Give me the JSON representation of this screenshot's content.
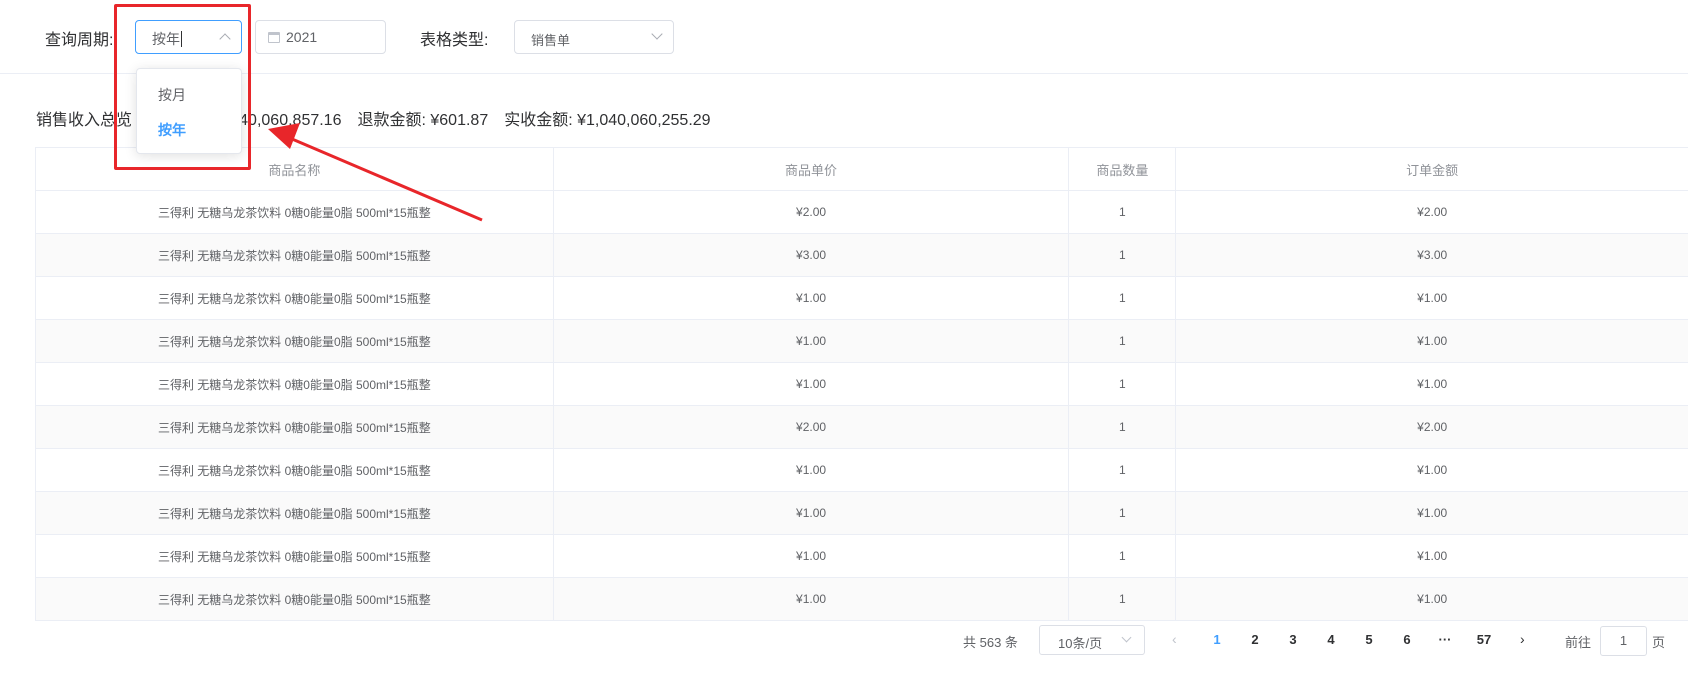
{
  "filters": {
    "period_label": "查询周期:",
    "period_value": "按年",
    "period_options": [
      "按月",
      "按年"
    ],
    "date_value": "2021",
    "type_label": "表格类型:",
    "type_value": "销售单"
  },
  "summary": {
    "label": "销售收入总览",
    "total_fragment": "：¥1,040,060,857.16",
    "refund": "退款金额: ¥601.87",
    "actual": "实收金额: ¥1,040,060,255.29"
  },
  "table": {
    "headers": [
      "商品名称",
      "商品单价",
      "商品数量",
      "订单金额"
    ],
    "rows": [
      [
        "三得利 无糖乌龙茶饮料 0糖0能量0脂 500ml*15瓶整",
        "¥2.00",
        "1",
        "¥2.00"
      ],
      [
        "三得利 无糖乌龙茶饮料 0糖0能量0脂 500ml*15瓶整",
        "¥3.00",
        "1",
        "¥3.00"
      ],
      [
        "三得利 无糖乌龙茶饮料 0糖0能量0脂 500ml*15瓶整",
        "¥1.00",
        "1",
        "¥1.00"
      ],
      [
        "三得利 无糖乌龙茶饮料 0糖0能量0脂 500ml*15瓶整",
        "¥1.00",
        "1",
        "¥1.00"
      ],
      [
        "三得利 无糖乌龙茶饮料 0糖0能量0脂 500ml*15瓶整",
        "¥1.00",
        "1",
        "¥1.00"
      ],
      [
        "三得利 无糖乌龙茶饮料 0糖0能量0脂 500ml*15瓶整",
        "¥2.00",
        "1",
        "¥2.00"
      ],
      [
        "三得利 无糖乌龙茶饮料 0糖0能量0脂 500ml*15瓶整",
        "¥1.00",
        "1",
        "¥1.00"
      ],
      [
        "三得利 无糖乌龙茶饮料 0糖0能量0脂 500ml*15瓶整",
        "¥1.00",
        "1",
        "¥1.00"
      ],
      [
        "三得利 无糖乌龙茶饮料 0糖0能量0脂 500ml*15瓶整",
        "¥1.00",
        "1",
        "¥1.00"
      ],
      [
        "三得利 无糖乌龙茶饮料 0糖0能量0脂 500ml*15瓶整",
        "¥1.00",
        "1",
        "¥1.00"
      ]
    ]
  },
  "pagination": {
    "total": "共 563 条",
    "page_size": "10条/页",
    "pages": [
      "1",
      "2",
      "3",
      "4",
      "5",
      "6",
      "···",
      "57"
    ],
    "current": "1",
    "goto_label": "前往",
    "goto_value": "1",
    "page_unit": "页"
  },
  "annotation": {
    "color": "#e8262a"
  },
  "colors": {
    "accent": "#409eff",
    "text": "#303133",
    "border": "#dcdfe6"
  },
  "icons": [
    "chevron-up-icon",
    "calendar-icon",
    "chevron-down-icon",
    "chevron-left-icon",
    "chevron-right-icon"
  ]
}
